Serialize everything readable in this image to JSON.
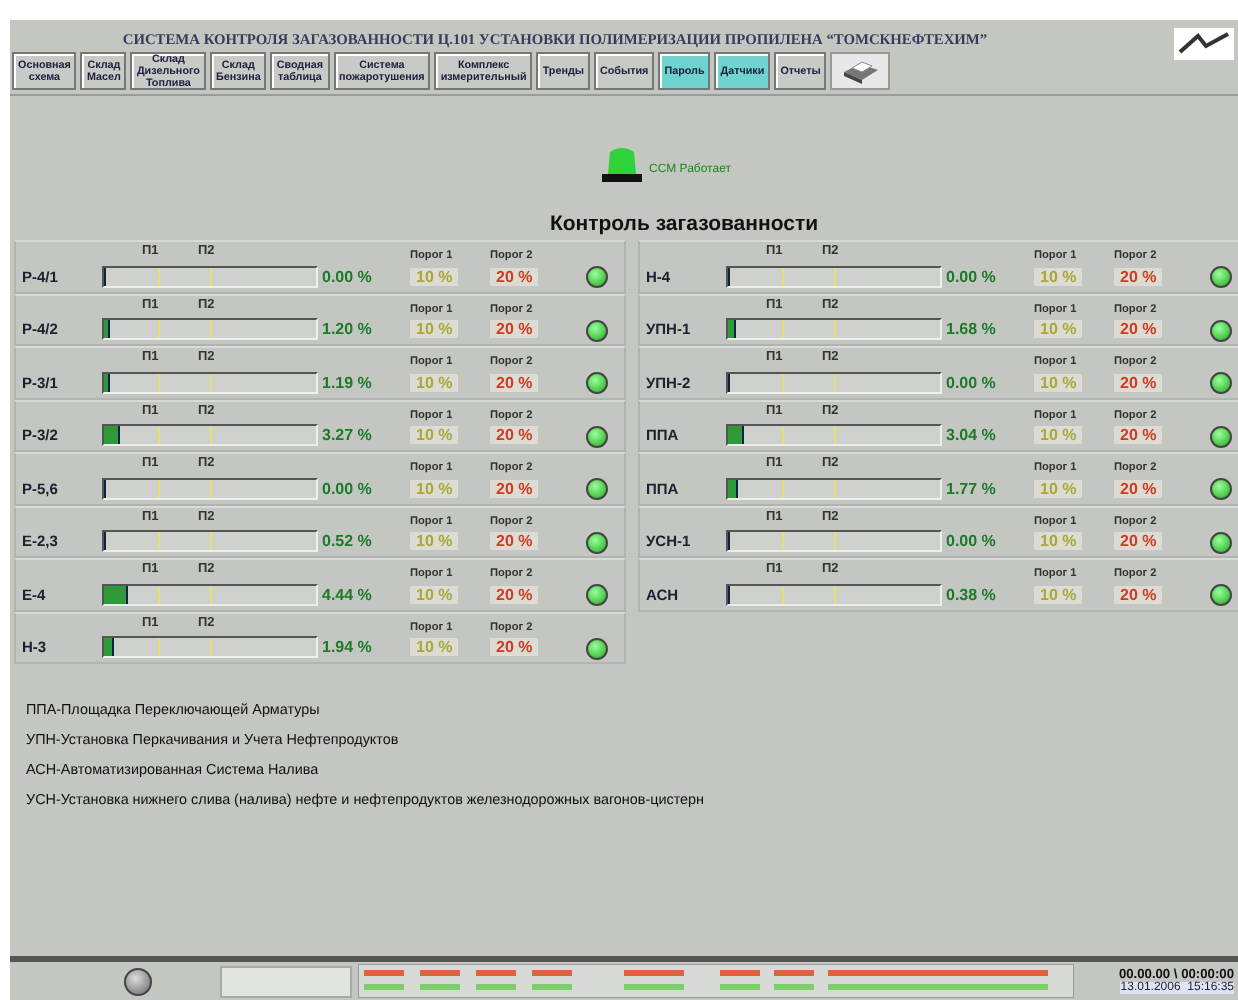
{
  "window": {
    "title": "СИСТЕМА КОНТРОЛЯ ЗАГАЗОВАННОСТИ Ц.101 УСТАНОВКИ ПОЛИМЕРИЗАЦИИ ПРОПИЛЕНА “ТОМСКНЕФТЕХИМ”"
  },
  "nav": [
    {
      "label": "Основная схема",
      "active": false
    },
    {
      "label": "Склад Масел",
      "active": false
    },
    {
      "label": "Склад Дизельного Топлива",
      "active": false
    },
    {
      "label": "Склад Бензина",
      "active": false
    },
    {
      "label": "Сводная таблица",
      "active": false
    },
    {
      "label": "Система пожаротушения",
      "active": false
    },
    {
      "label": "Комплекс измерительный",
      "active": false
    },
    {
      "label": "Тренды",
      "active": false
    },
    {
      "label": "События",
      "active": false
    },
    {
      "label": "Пароль",
      "active": true
    },
    {
      "label": "Датчики",
      "active": true
    },
    {
      "label": "Отчеты",
      "active": false
    }
  ],
  "status": {
    "text": "ССМ Работает",
    "ok": true
  },
  "heading": "Контроль загазованности",
  "sensor_columns": [
    [
      {
        "name": "Р-4/1",
        "level": 0,
        "reading": "0.00 %",
        "p1": "П1",
        "p2": "П2",
        "t1_label": "Порог 1",
        "t1": "10 %",
        "t2_label": "Порог 2",
        "t2": "20 %",
        "ok": true
      },
      {
        "name": "Р-4/2",
        "level": 0.03,
        "reading": "1.20 %",
        "p1": "П1",
        "p2": "П2",
        "t1_label": "Порог 1",
        "t1": "10 %",
        "t2_label": "Порог 2",
        "t2": "20 %",
        "ok": true
      },
      {
        "name": "Р-3/1",
        "level": 0.03,
        "reading": "1.19 %",
        "p1": "П1",
        "p2": "П2",
        "t1_label": "Порог 1",
        "t1": "10 %",
        "t2_label": "Порог 2",
        "t2": "20 %",
        "ok": true
      },
      {
        "name": "Р-3/2",
        "level": 0.08,
        "reading": "3.27 %",
        "p1": "П1",
        "p2": "П2",
        "t1_label": "Порог 1",
        "t1": "10 %",
        "t2_label": "Порог 2",
        "t2": "20 %",
        "ok": true
      },
      {
        "name": "Р-5,6",
        "level": 0,
        "reading": "0.00 %",
        "p1": "П1",
        "p2": "П2",
        "t1_label": "Порог 1",
        "t1": "10 %",
        "t2_label": "Порог 2",
        "t2": "20 %",
        "ok": true
      },
      {
        "name": "Е-2,3",
        "level": 0.013,
        "reading": "0.52 %",
        "p1": "П1",
        "p2": "П2",
        "t1_label": "Порог 1",
        "t1": "10 %",
        "t2_label": "Порог 2",
        "t2": "20 %",
        "ok": true
      },
      {
        "name": "Е-4",
        "level": 0.111,
        "reading": "4.44 %",
        "p1": "П1",
        "p2": "П2",
        "t1_label": "Порог 1",
        "t1": "10 %",
        "t2_label": "Порог 2",
        "t2": "20 %",
        "ok": true
      },
      {
        "name": "Н-3",
        "level": 0.049,
        "reading": "1.94 %",
        "p1": "П1",
        "p2": "П2",
        "t1_label": "Порог 1",
        "t1": "10 %",
        "t2_label": "Порог 2",
        "t2": "20 %",
        "ok": true
      }
    ],
    [
      {
        "name": "Н-4",
        "level": 0,
        "reading": "0.00 %",
        "p1": "П1",
        "p2": "П2",
        "t1_label": "Порог 1",
        "t1": "10 %",
        "t2_label": "Порог 2",
        "t2": "20 %",
        "ok": true
      },
      {
        "name": "УПН-1",
        "level": 0.042,
        "reading": "1.68 %",
        "p1": "П1",
        "p2": "П2",
        "t1_label": "Порог 1",
        "t1": "10 %",
        "t2_label": "Порог 2",
        "t2": "20 %",
        "ok": true
      },
      {
        "name": "УПН-2",
        "level": 0,
        "reading": "0.00 %",
        "p1": "П1",
        "p2": "П2",
        "t1_label": "Порог 1",
        "t1": "10 %",
        "t2_label": "Порог 2",
        "t2": "20 %",
        "ok": true
      },
      {
        "name": "ППА",
        "level": 0.076,
        "reading": "3.04 %",
        "p1": "П1",
        "p2": "П2",
        "t1_label": "Порог 1",
        "t1": "10 %",
        "t2_label": "Порог 2",
        "t2": "20 %",
        "ok": true
      },
      {
        "name": "ППА",
        "level": 0.044,
        "reading": "1.77 %",
        "p1": "П1",
        "p2": "П2",
        "t1_label": "Порог 1",
        "t1": "10 %",
        "t2_label": "Порог 2",
        "t2": "20 %",
        "ok": true
      },
      {
        "name": "УСН-1",
        "level": 0,
        "reading": "0.00 %",
        "p1": "П1",
        "p2": "П2",
        "t1_label": "Порог 1",
        "t1": "10 %",
        "t2_label": "Порог 2",
        "t2": "20 %",
        "ok": true
      },
      {
        "name": "АСН",
        "level": 0.0095,
        "reading": "0.38 %",
        "p1": "П1",
        "p2": "П2",
        "t1_label": "Порог 1",
        "t1": "10 %",
        "t2_label": "Порог 2",
        "t2": "20 %",
        "ok": true
      }
    ]
  ],
  "legend": [
    "ППА-Площадка Переключающей Арматуры",
    "УПН-Установка Перкачивания и Учета Нефтепродуктов",
    "АСН-Автоматизированная Система Налива",
    "УСН-Установка нижнего слива (налива) нефте и нефтепродуктов железнодорожных вагонов-цистерн"
  ],
  "clock": {
    "counter": "00.00.00 \\ 00:00:00",
    "datetime": "13.01.2006  15:16:35"
  }
}
